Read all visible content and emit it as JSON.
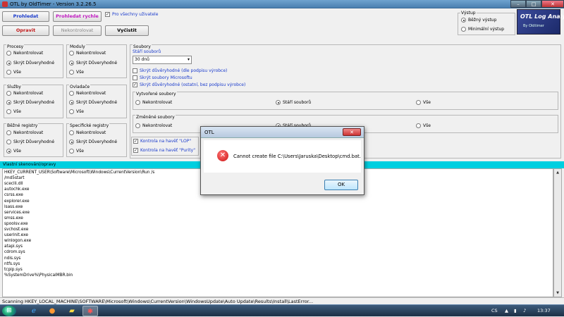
{
  "window": {
    "title": "OTL by OldTimer - Version 3.2.26.5"
  },
  "toolbar": {
    "scan_label": "Prohledat",
    "quick_scan_label": "Prohledat rychle",
    "all_users_label": "Pro všechny uživatele",
    "fix_label": "Opravit",
    "check_label": "Nekontrolovat",
    "clean_label": "Vyčistit"
  },
  "output": {
    "title": "Výstup",
    "standard": "Běžný výstup",
    "minimal": "Minimální výstup"
  },
  "logo": {
    "text": "OTL Log Analysis",
    "sub": "By Oldtimer"
  },
  "groups": {
    "processes": {
      "title": "Procesy",
      "opts": [
        "Nekontrolovat",
        "Skrýt Důveryhodné",
        "Vše"
      ]
    },
    "modules": {
      "title": "Moduly",
      "opts": [
        "Nekontrolovat",
        "Skrýt Důveryhodné",
        "Vše"
      ]
    },
    "services": {
      "title": "Služby",
      "opts": [
        "Nekontrolovat",
        "Skrýt Důveryhodné",
        "Vše"
      ]
    },
    "drivers": {
      "title": "Ovladače",
      "opts": [
        "Nekontrolovat",
        "Skrýt Důveryhodné",
        "Vše"
      ]
    },
    "registry": {
      "title": "Běžné registry",
      "opts": [
        "Nekontrolovat",
        "Skrýt Důveryhodné",
        "Vše"
      ]
    },
    "special_registry": {
      "title": "Specifické registry",
      "opts": [
        "Nekontrolovat",
        "Skrýt Důveryhodné",
        "Vše"
      ]
    }
  },
  "files": {
    "title": "Soubory",
    "age_label": "Stáří souborů",
    "age_value": "30 dnů",
    "chk1": "Skrýt důvěryhodné (dle podpisu výrobce)",
    "chk2": "Skrýt soubory Microsoftu",
    "chk3": "Skrýt důvěryhodné (ostatní, bez podpisu výrobce)",
    "created_title": "Vytvořené soubory",
    "modified_title": "Změněné soubory",
    "opt_none": "Nekontrolovat",
    "opt_age": "Stáří souborů",
    "opt_all": "Vše",
    "lop": "Kontrola na havěť \"LOP\"",
    "purity": "Kontrola na havěť \"Purity\""
  },
  "custom": {
    "title": "Vlastní skenování/opravy",
    "lines": [
      "HKEY_CURRENT_USER\\Software\\Microsoft\\Windows\\CurrentVersion\\Run /s",
      "/md5start",
      "sceclli.dll",
      "autochk.exe",
      "csrss.exe",
      "explorer.exe",
      "lsass.exe",
      "services.exe",
      "smss.exe",
      "spoolsv.exe",
      "svchost.exe",
      "userinit.exe",
      "winlogon.exe",
      "atapi.sys",
      "cdrom.sys",
      "ndis.sys",
      "ntfs.sys",
      "tcpip.sys",
      "%SystemDrive%\\PhysicalMBR.bin"
    ]
  },
  "status": "Scanning HKEY_LOCAL_MACHINE\\SOFTWARE\\Microsoft\\Windows\\CurrentVersion\\WindowsUpdate\\Auto Update\\Results\\Install\\LastError...",
  "dialog": {
    "title": "OTL",
    "message": "Cannot create file C:\\Users\\Jaruska\\Desktop\\cmd.bat.",
    "ok": "OK"
  },
  "tray": {
    "lang": "CS",
    "time": "13:37"
  }
}
